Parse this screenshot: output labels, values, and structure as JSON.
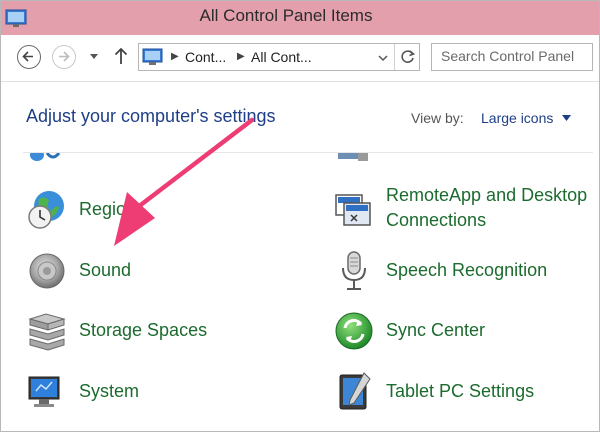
{
  "window": {
    "title": "All Control Panel Items"
  },
  "address_bar": {
    "breadcrumbs": [
      "Cont...",
      "All Cont..."
    ],
    "search_placeholder": "Search Control Panel"
  },
  "header": {
    "heading": "Adjust your computer's settings",
    "view_by_label": "View by:",
    "view_by_value": "Large icons"
  },
  "items": [
    {
      "label": "Region",
      "icon": "globe-clock-icon"
    },
    {
      "label_line1": "RemoteApp and Desktop",
      "label_line2": "Connections",
      "icon": "remoteapp-icon"
    },
    {
      "label": "Sound",
      "icon": "speaker-icon"
    },
    {
      "label": "Speech Recognition",
      "icon": "microphone-icon"
    },
    {
      "label": "Storage Spaces",
      "icon": "storage-drives-icon"
    },
    {
      "label": "Sync Center",
      "icon": "sync-icon"
    },
    {
      "label": "System",
      "icon": "computer-icon"
    },
    {
      "label": "Tablet PC Settings",
      "icon": "tablet-icon"
    }
  ],
  "colors": {
    "title_bar": "#e3a0ac",
    "heading": "#1e3f87",
    "item_label": "#1c6b2e",
    "annotation_arrow": "#ee3d74"
  }
}
